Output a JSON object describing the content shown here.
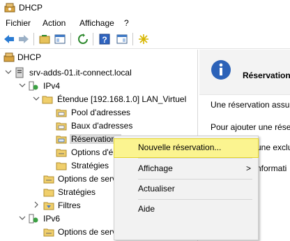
{
  "window": {
    "title": "DHCP"
  },
  "menu": {
    "items": [
      "Fichier",
      "Action",
      "Affichage",
      "?"
    ]
  },
  "tree": {
    "root": "DHCP",
    "server": "srv-adds-01.it-connect.local",
    "ipv4": "IPv4",
    "scope": "Étendue [192.168.1.0] LAN_Virtuel",
    "pool": "Pool d'adresses",
    "leases": "Baux d'adresses",
    "reservations": "Réservations",
    "scope_options": "Options d'é",
    "policies_scope": "Stratégies",
    "server_options": "Options de serve",
    "policies": "Stratégies",
    "filters": "Filtres",
    "ipv6": "IPv6",
    "ipv6_server_options": "Options de serveur"
  },
  "right_pane": {
    "header": "Réservation",
    "line1": "Une réservation assur",
    "line2": "Pour ajouter une réser",
    "line3": "une exclu",
    "line4": "nformati"
  },
  "context_menu": {
    "new_reservation": "Nouvelle réservation...",
    "view": "Affichage",
    "refresh": "Actualiser",
    "help": "Aide",
    "submenu_arrow": ">"
  }
}
